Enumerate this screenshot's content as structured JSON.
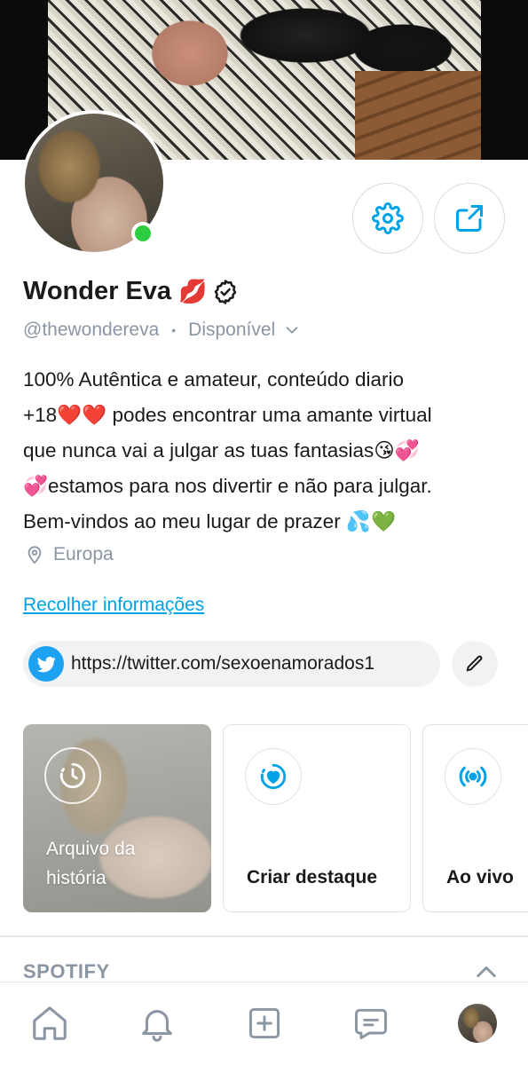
{
  "profile": {
    "name": "Wonder Eva",
    "name_emoji": "💋",
    "handle": "@thewondereva",
    "status": "Disponível",
    "bio": "100% Autêntica e amateur, conteúdo diario\n+18❤️❤️ podes encontrar uma amante virtual\nque nunca vai a julgar as tuas fantasias😘💞\n💞estamos para nos divertir e não para julgar.\nBem-vindos ao meu lugar de prazer 💦💚",
    "location": "Europa",
    "collapse_label": "Recolher informações",
    "link": "https://twitter.com/sexoenamorados1"
  },
  "cards": {
    "archive_label": "Arquivo da\nhistória",
    "highlight_label": "Criar destaque",
    "live_label": "Ao vivo"
  },
  "sections": {
    "spotify_title": "SPOTIFY"
  },
  "colors": {
    "accent": "#00a2e6",
    "online": "#2ecc40",
    "twitter": "#1da1f2",
    "muted": "#8a96a3"
  },
  "icons": {
    "settings": "gear-icon",
    "share": "share-icon",
    "verified": "verified-badge-icon",
    "location": "location-pin-icon",
    "twitter": "twitter-bird-icon",
    "edit": "pencil-icon",
    "archive": "clock-history-icon",
    "highlight": "heart-circle-icon",
    "live": "broadcast-icon",
    "collapse": "chevron-up-icon",
    "tabs": [
      "home-icon",
      "bell-icon",
      "plus-square-icon",
      "message-icon",
      "avatar"
    ]
  }
}
